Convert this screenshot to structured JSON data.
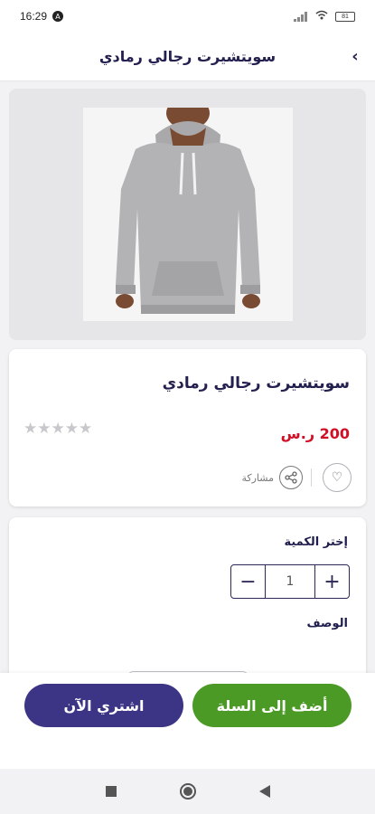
{
  "status_bar": {
    "time": "16:29",
    "notification_glyph": "A",
    "battery_level": "81"
  },
  "header": {
    "title": "سويتشيرت رجالي رمادي",
    "back_glyph": "‹"
  },
  "product": {
    "name": "سويتشيرت رجالي رمادي",
    "price": "200 ر.س",
    "rating_stars": "★★★★★",
    "rating_value": 0,
    "rating_max": 5,
    "share_label": "مشاركة",
    "wishlist_glyph": "♡"
  },
  "options": {
    "quantity_label": "إختر الكمية",
    "quantity_value": "1",
    "minus_glyph": "−",
    "plus_glyph": "+",
    "description_label": "الوصف"
  },
  "actions": {
    "add_to_cart_label": "أضف إلى السلة",
    "buy_now_label": "اشتري الآن"
  },
  "colors": {
    "primary": "#3c3585",
    "success": "#4b9a26",
    "price": "#d10f26",
    "title": "#23204f"
  }
}
